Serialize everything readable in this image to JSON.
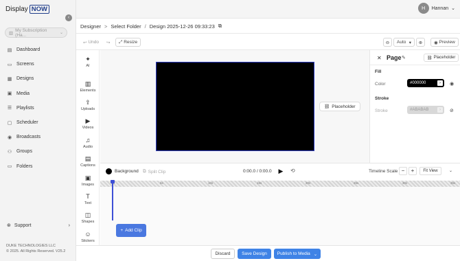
{
  "app": {
    "logo_text": "Display",
    "logo_badge": "NOW",
    "collapse_icon": "chevron-left-icon"
  },
  "sidebar": {
    "subscription_placeholder": "My Subscription (Ha...",
    "items": [
      {
        "label": "Dashboard",
        "icon": "▤"
      },
      {
        "label": "Screens",
        "icon": "▭"
      },
      {
        "label": "Designs",
        "icon": "▦"
      },
      {
        "label": "Media",
        "icon": "▣"
      },
      {
        "label": "Playlists",
        "icon": "☰"
      },
      {
        "label": "Scheduler",
        "icon": "▢"
      },
      {
        "label": "Broadcasts",
        "icon": "◉"
      },
      {
        "label": "Groups",
        "icon": "⚇"
      },
      {
        "label": "Folders",
        "icon": "▭"
      }
    ],
    "support_label": "Support",
    "footer_line1": "DUKE TECHNOLOGIES LLC",
    "footer_line2": "© 2025. All Rights Reserved. V25.2"
  },
  "header": {
    "user_initial": "H",
    "user_name": "Hannan"
  },
  "breadcrumb": {
    "items": [
      "Designer",
      "Select Folder",
      "Design 2025-12-26 09:33:23"
    ],
    "sep1": ">",
    "sep2": "/"
  },
  "toolbar": {
    "undo": "Undo",
    "redo": "↪",
    "resize": "Resize",
    "zoom_value": "Auto",
    "preview": "Preview"
  },
  "tools": [
    "AI",
    "Elements",
    "Uploads",
    "Videos",
    "Audio",
    "Captions",
    "Images",
    "Text",
    "Shapes",
    "Stickers"
  ],
  "canvas": {
    "placeholder_label": "Placeholder",
    "background_color": "#000000"
  },
  "panel": {
    "title": "Page",
    "placeholder_label": "Placeholder",
    "fill_heading": "Fill",
    "color_label": "Color",
    "color_value": "#000000",
    "stroke_heading": "Stroke",
    "stroke_label": "Stroke",
    "stroke_value": "#ABABAB"
  },
  "timeline": {
    "background_label": "Background",
    "split_clip_label": "Split Clip",
    "time_display": "0:00.0 / 0:00.0",
    "scale_label": "Timeline Scale",
    "fit_view_label": "Fit View",
    "ruler_ticks": [
      "0s",
      "5s",
      "10s",
      "15s",
      "20s",
      "25s",
      "30s",
      "35s"
    ],
    "add_clip_label": "Add Clip"
  },
  "actions": {
    "discard": "Discard",
    "save_design": "Save Design",
    "publish": "Publish to Media"
  }
}
